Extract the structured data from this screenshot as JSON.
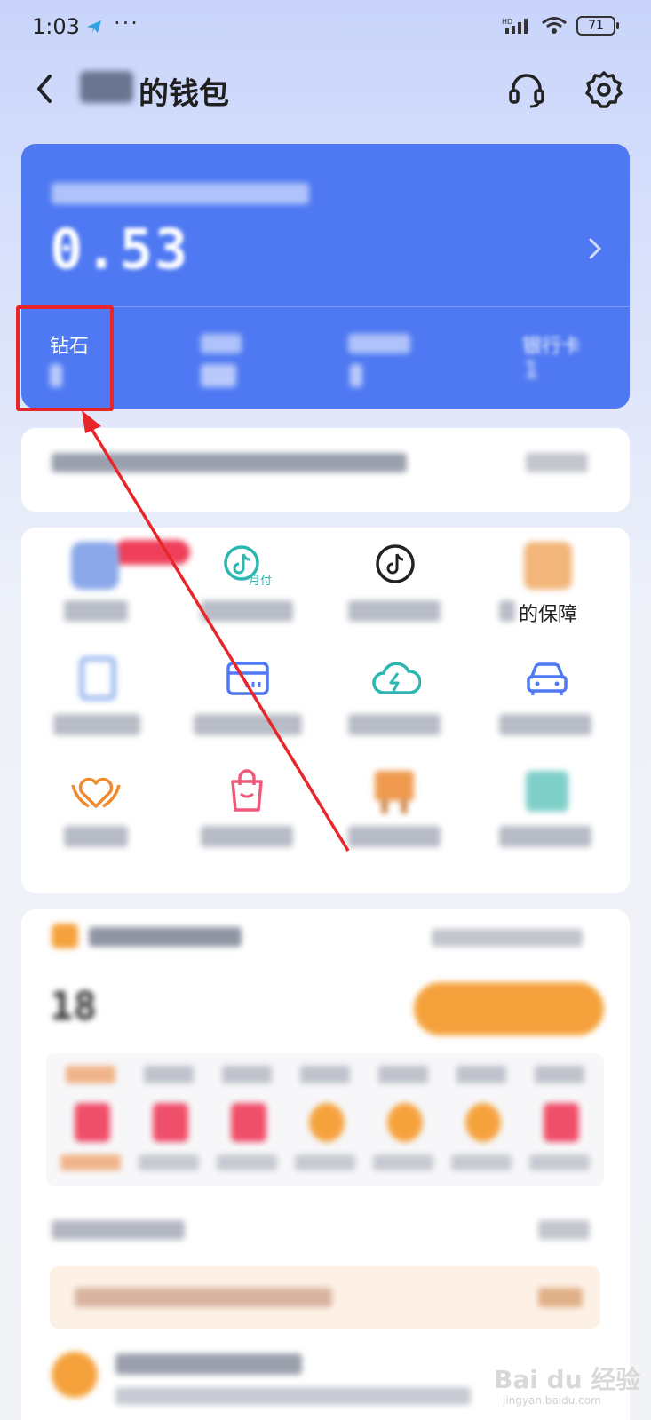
{
  "status_bar": {
    "time": "1:03",
    "dots": "···",
    "network": "HD",
    "battery": "71"
  },
  "header": {
    "title": "的钱包"
  },
  "balance_card": {
    "balance": "0.53",
    "assets": [
      {
        "label": "钻石"
      },
      {
        "label": "银行卡",
        "value": "1"
      }
    ]
  },
  "services": {
    "items": [
      {
        "icon": "blurred-icon-blue"
      },
      {
        "icon": "douyin-monthly-pay-icon",
        "icon_text": "月付"
      },
      {
        "icon": "douyin-logo-icon"
      },
      {
        "icon": "shield-box-icon",
        "label": "的保障"
      },
      {
        "icon": "phone-icon"
      },
      {
        "icon": "card-icon"
      },
      {
        "icon": "cloud-bolt-icon"
      },
      {
        "icon": "car-icon"
      },
      {
        "icon": "heart-hands-icon"
      },
      {
        "icon": "shopping-bag-icon"
      },
      {
        "icon": "signpost-icon"
      },
      {
        "icon": "gift-icon"
      }
    ]
  },
  "points": {
    "value": "18"
  },
  "watermark": {
    "brand": "Bai du 经验",
    "url": "jingyan.baidu.com"
  },
  "colors": {
    "card_blue": "#4f79f2",
    "highlight_red": "#e8252b",
    "checkin_orange": "#f5a23c"
  }
}
